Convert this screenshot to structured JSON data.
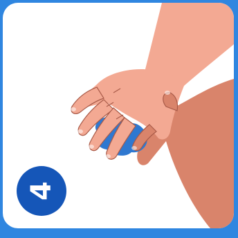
{
  "step": {
    "number": "4"
  },
  "illustration": {
    "subject": "hands-rubbing-fingers-icon"
  },
  "colors": {
    "frame": "#2f86e0",
    "card": "#ffffff",
    "skin_light": "#f3a993",
    "skin_dark": "#d9846b",
    "skin_outline": "#a85a48",
    "water_blue": "#2f78d0",
    "badge": "#1556b8",
    "badge_text": "#ffffff"
  }
}
